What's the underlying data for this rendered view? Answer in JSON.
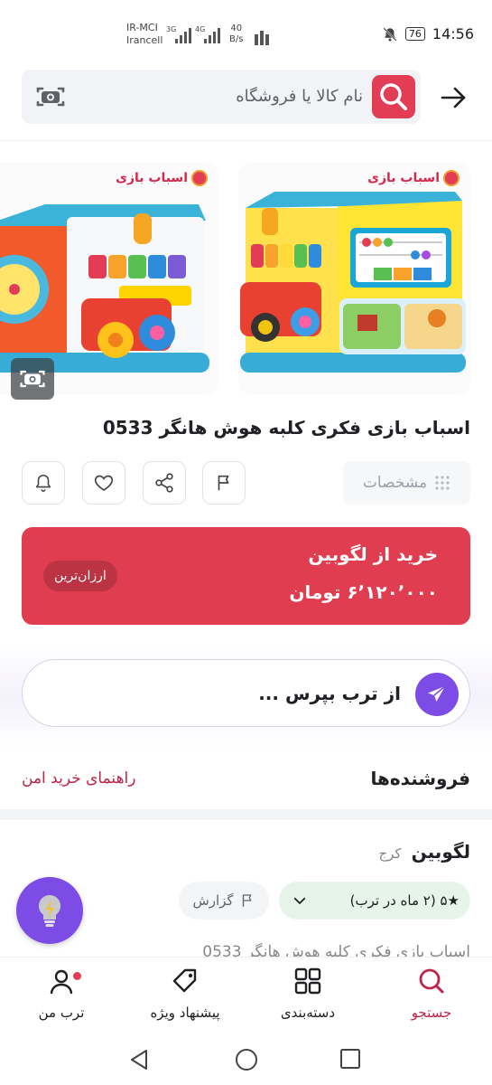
{
  "status_bar": {
    "operator_line1": "IR-MCI",
    "operator_line2": "Irancell",
    "sim1_type": "3G",
    "sim2_type": "4G",
    "net_speed_value": "40",
    "net_speed_unit": "B/s",
    "battery": "76",
    "time": "14:56"
  },
  "search": {
    "placeholder": "نام کالا یا فروشگاه"
  },
  "gallery": {
    "brand_logo_text": "اسباب بازی"
  },
  "product": {
    "title": "اسباب بازی فکری کلبه هوش هانگر 0533",
    "specs_label": "مشخصات"
  },
  "buy_card": {
    "store": "خرید از لگوبین",
    "price": "۶٬۱۲۰٬۰۰۰ تومان",
    "badge": "ارزان‌ترین"
  },
  "ai_box": {
    "prompt": "از ترب بپرس ..."
  },
  "sellers": {
    "title": "فروشنده‌ها",
    "guide_link": "راهنمای خرید امن",
    "first": {
      "name": "لگوبین",
      "city": "کرج",
      "rating": "★۵ (۲ ماه در ترب)",
      "report": "گزارش",
      "description": "اسباب بازی فکری کلبه هوش هانگر 0533"
    }
  },
  "bottom_nav": [
    {
      "label": "جستجو",
      "icon": "search-icon",
      "active": true
    },
    {
      "label": "دسته‌بندی",
      "icon": "grid-icon",
      "active": false
    },
    {
      "label": "پیشنهاد ویژه",
      "icon": "tag-icon",
      "active": false
    },
    {
      "label": "ترب من",
      "icon": "user-icon",
      "active": false
    }
  ],
  "colors": {
    "accent": "#e23d55",
    "buy_card": "#e03d51",
    "ai_purple": "#7d4be6",
    "rating_bg": "#e6f4ea",
    "link": "#c0234a"
  }
}
